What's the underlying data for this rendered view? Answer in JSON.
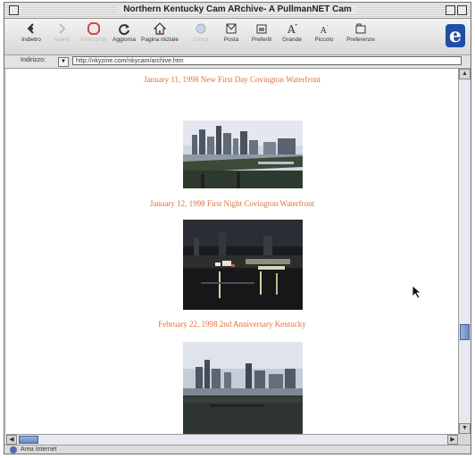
{
  "window": {
    "title": "Northern Kentucky Cam ARchive- A PullmanNET Cam"
  },
  "toolbar": {
    "back_label": "Indietro",
    "forward_label": "Avanti",
    "stop_label": "Interrompi",
    "reload_label": "Aggiorna",
    "home_label": "Pagina iniziale",
    "search_label": "Cerca",
    "mail_label": "Posta",
    "favorites_label": "Preferiti",
    "larger_label": "Grande",
    "smaller_label": "Piccolo",
    "preferences_label": "Preferenze",
    "icons": [
      "back-arrow-icon",
      "forward-arrow-icon",
      "stop-icon",
      "reload-icon",
      "home-icon",
      "search-icon",
      "mail-icon",
      "favorites-icon",
      "larger-text-icon",
      "smaller-text-icon",
      "preferences-icon"
    ]
  },
  "address": {
    "label": "Indirizzo:",
    "url": "http://nkyzine.com/nkycam/archive.htm"
  },
  "content": {
    "entries": [
      {
        "caption": "January 11, 1998 New First Day Covington Waterfront",
        "image": "waterfront-skyline-day"
      },
      {
        "caption": "January 12, 1998 First Night Covington Waterfront",
        "image": "waterfront-night"
      },
      {
        "caption": "February 22, 1998 2nd Anniversary Kentucky",
        "image": "waterfront-skyline-overcast"
      }
    ]
  },
  "status": {
    "text": "Area Internet"
  },
  "colors": {
    "caption": "#e0703a",
    "scroll_thumb": "#6b88c0",
    "ie_logo": "#1f4ea8"
  }
}
